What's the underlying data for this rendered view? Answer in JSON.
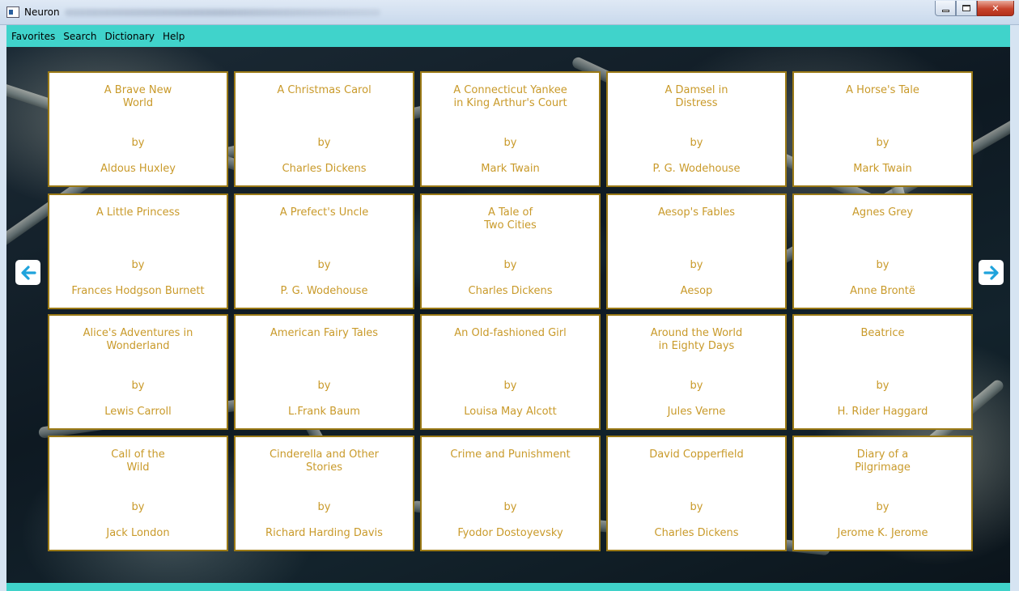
{
  "window": {
    "title": "Neuron"
  },
  "menu": [
    "Favorites",
    "Search",
    "Dictionary",
    "Help"
  ],
  "nav": {
    "prev_icon": "arrow-left-icon",
    "next_icon": "arrow-right-icon",
    "arrow_color": "#1fa3dc"
  },
  "colors": {
    "accent": "#40d3cb",
    "card_text": "#c99a2a",
    "card_border": "#9b7a16"
  },
  "books": [
    {
      "title": "A Brave New\nWorld",
      "by": "by",
      "author": "Aldous Huxley"
    },
    {
      "title": "A Christmas Carol",
      "by": "by",
      "author": "Charles Dickens"
    },
    {
      "title": "A Connecticut Yankee\nin King Arthur's Court",
      "by": "by",
      "author": "Mark Twain"
    },
    {
      "title": "A Damsel in\nDistress",
      "by": "by",
      "author": "P. G. Wodehouse"
    },
    {
      "title": "A Horse's Tale",
      "by": "by",
      "author": "Mark Twain"
    },
    {
      "title": "A Little Princess",
      "by": "by",
      "author": "Frances Hodgson Burnett"
    },
    {
      "title": "A Prefect's Uncle",
      "by": "by",
      "author": "P. G. Wodehouse"
    },
    {
      "title": "A Tale of\nTwo Cities",
      "by": "by",
      "author": "Charles Dickens"
    },
    {
      "title": "Aesop's Fables",
      "by": "by",
      "author": "Aesop"
    },
    {
      "title": "Agnes Grey",
      "by": "by",
      "author": "Anne Brontë"
    },
    {
      "title": "Alice's Adventures in\nWonderland",
      "by": "by",
      "author": "Lewis Carroll"
    },
    {
      "title": "American Fairy Tales",
      "by": "by",
      "author": "L.Frank Baum"
    },
    {
      "title": "An Old-fashioned Girl",
      "by": "by",
      "author": "Louisa May Alcott"
    },
    {
      "title": "Around the World\nin Eighty Days",
      "by": "by",
      "author": "Jules Verne"
    },
    {
      "title": "Beatrice",
      "by": "by",
      "author": "H. Rider Haggard"
    },
    {
      "title": "Call of the\nWild",
      "by": "by",
      "author": "Jack London"
    },
    {
      "title": "Cinderella and Other\nStories",
      "by": "by",
      "author": "Richard Harding Davis"
    },
    {
      "title": "Crime and Punishment",
      "by": "by",
      "author": "Fyodor Dostoyevsky"
    },
    {
      "title": "David Copperfield",
      "by": "by",
      "author": "Charles Dickens"
    },
    {
      "title": "Diary of a\nPilgrimage",
      "by": "by",
      "author": "Jerome K. Jerome"
    }
  ]
}
